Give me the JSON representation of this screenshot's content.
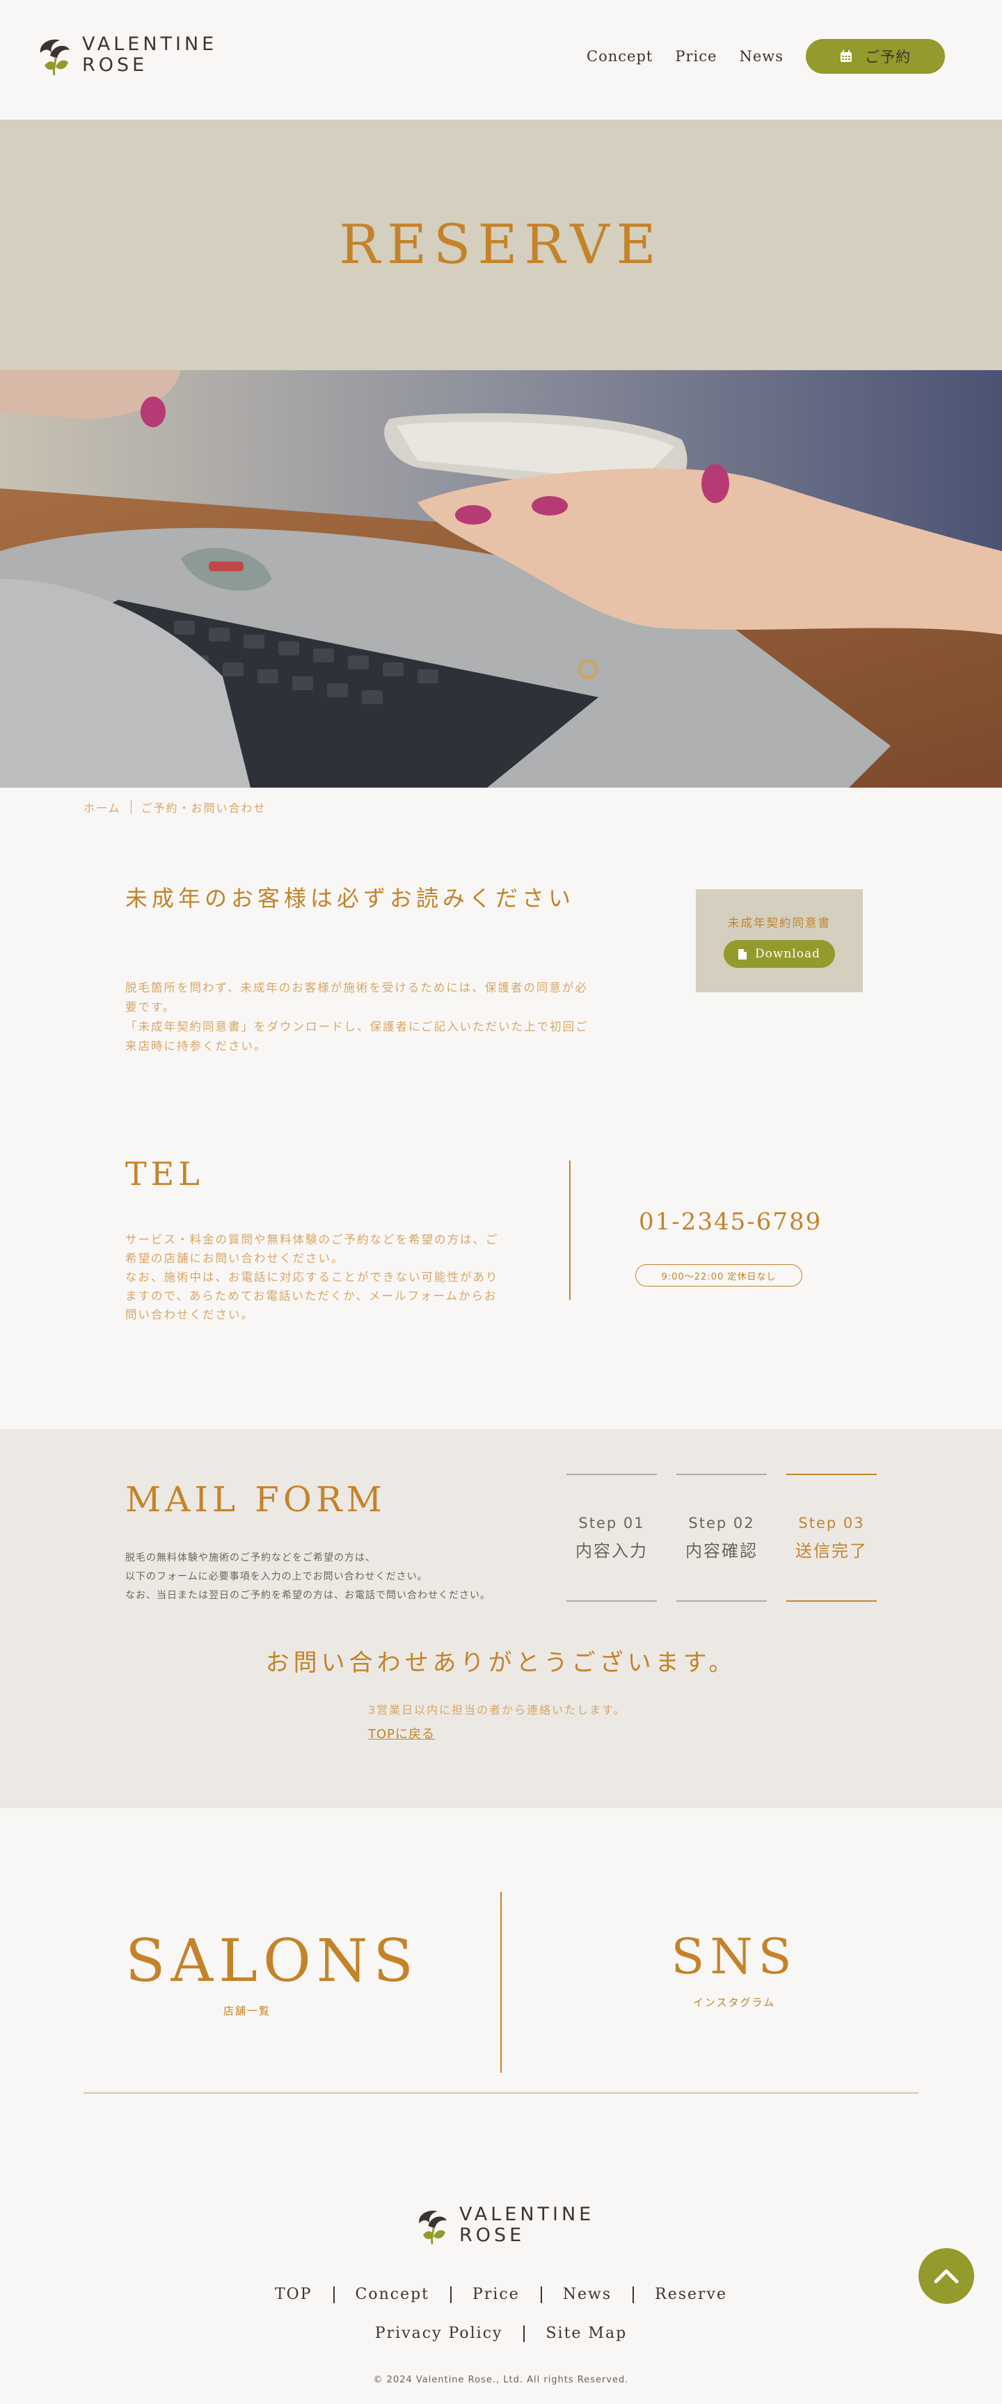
{
  "header": {
    "logo_line1": "VALENTINE",
    "logo_line2": "ROSE",
    "nav": [
      "Concept",
      "Price",
      "News"
    ],
    "reserve_button": "ご予約",
    "icons": {
      "reserve": "calendar-icon"
    }
  },
  "hero": {
    "title": "RESERVE"
  },
  "breadcrumb": {
    "home": "ホーム",
    "current": "ご予約・お問い合わせ"
  },
  "minors": {
    "title": "未成年のお客様は必ずお読みください",
    "lines": [
      "脱毛箇所を問わず、未成年のお客様が施術を受けるためには、保護者の同意が必",
      "要です。",
      "「未成年契約同意書」をダウンロードし、保護者にご記入いただいた上で初回ご",
      "来店時に持参ください。"
    ],
    "download_box_title": "未成年契約同意書",
    "download_button": "Download",
    "icons": {
      "download": "file-icon"
    }
  },
  "tel": {
    "title": "TEL",
    "lines": [
      "サービス・料金の質問や無料体験のご予約などを希望の方は、ご",
      "希望の店舗にお問い合わせください。",
      "なお、施術中は、お電話に対応することができない可能性があり",
      "ますので、あらためてお電話いただくか、メールフォームからお",
      "問い合わせください。"
    ],
    "number": "01-2345-6789",
    "hours": "9:00〜22:00 定休日なし"
  },
  "mail": {
    "title": "MAIL FORM",
    "intro": [
      "脱毛の無料体験や施術のご予約などをご希望の方は、",
      "以下のフォームに必要事項を入力の上でお問い合わせください。",
      "なお、当日または翌日のご予約を希望の方は、お電話で問い合わせください。"
    ],
    "steps": [
      {
        "num": "Step 01",
        "label": "内容入力"
      },
      {
        "num": "Step 02",
        "label": "内容確認"
      },
      {
        "num": "Step 03",
        "label": "送信完了"
      }
    ],
    "active_step": 3,
    "thanks": "お問い合わせありがとうございます。",
    "reply": "3営業日以内に担当の者から連絡いたします。",
    "top_link": "TOPに戻る"
  },
  "links": {
    "salons": {
      "title": "SALONS",
      "sub": "店舗一覧"
    },
    "sns": {
      "title": "SNS",
      "sub": "インスタグラム"
    }
  },
  "footer": {
    "logo_line1": "VALENTINE",
    "logo_line2": "ROSE",
    "nav_row1": [
      "TOP",
      "Concept",
      "Price",
      "News",
      "Reserve"
    ],
    "nav_row2": [
      "Privacy Policy",
      "Site Map"
    ],
    "copyright": "© 2024 Valentine Rose., Ltd. All rights Reserved.",
    "icons": {
      "page_top": "chevron-up-icon"
    }
  },
  "colors": {
    "accent_gold": "#c4832a",
    "accent_green": "#949a2c",
    "hero_bg": "#d4cfbe",
    "mail_bg": "#ece9e4",
    "text_dark": "#3e3330"
  }
}
